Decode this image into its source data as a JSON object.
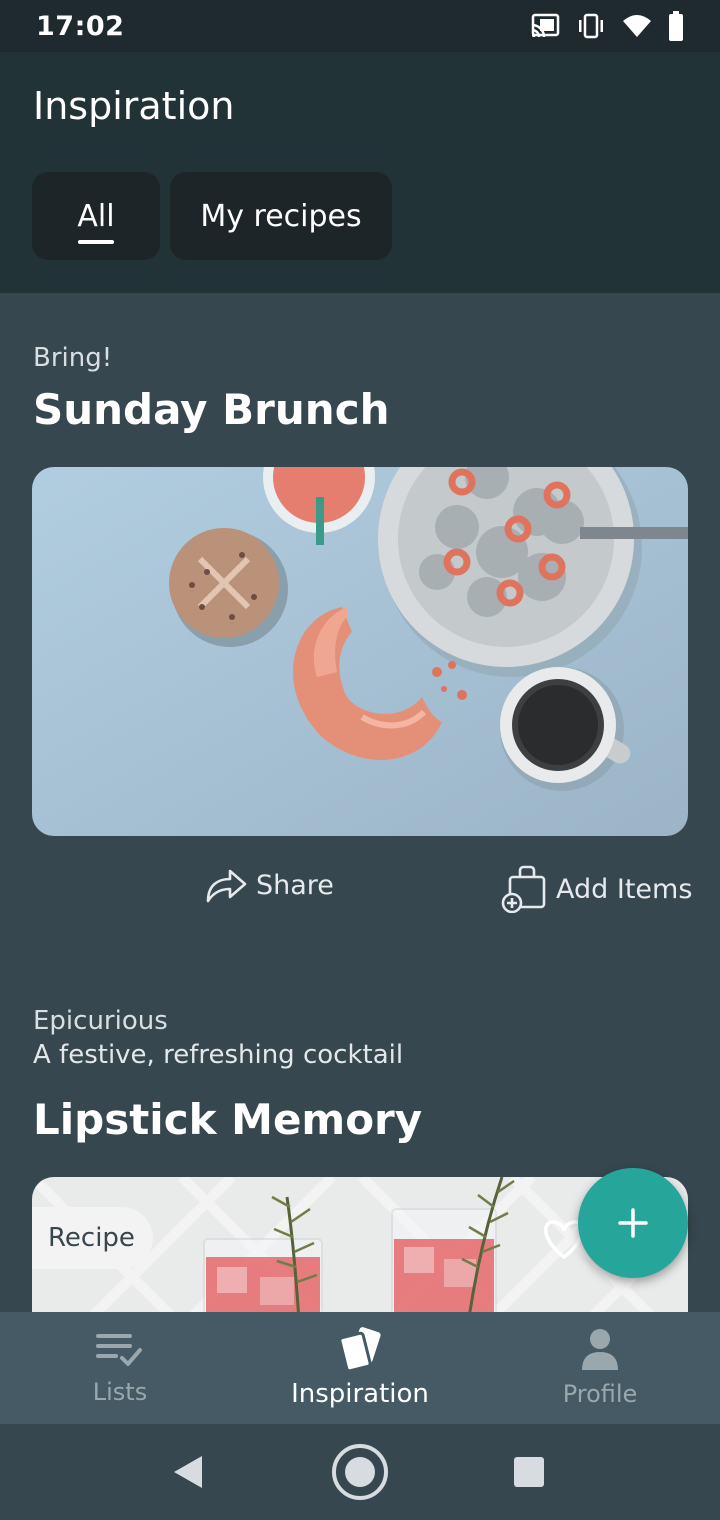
{
  "status": {
    "time": "17:02"
  },
  "header": {
    "title": "Inspiration",
    "tabs": [
      {
        "label": "All",
        "selected": true
      },
      {
        "label": "My recipes",
        "selected": false
      }
    ]
  },
  "cards": [
    {
      "source": "Bring!",
      "title": "Sunday Brunch",
      "favorited": true,
      "actions": {
        "share": "Share",
        "add_items": "Add Items"
      }
    },
    {
      "source": "Epicurious",
      "subtitle": "A festive, refreshing cocktail",
      "title": "Lipstick Memory",
      "badge": "Recipe",
      "favorited": false
    }
  ],
  "bottom_nav": {
    "items": [
      {
        "label": "Lists",
        "icon": "lists-icon",
        "active": false
      },
      {
        "label": "Inspiration",
        "icon": "inspiration-icon",
        "active": true
      },
      {
        "label": "Profile",
        "icon": "profile-icon",
        "active": false
      }
    ]
  },
  "colors": {
    "accent": "#26a69a",
    "background": "#37474f",
    "header": "#223338"
  }
}
